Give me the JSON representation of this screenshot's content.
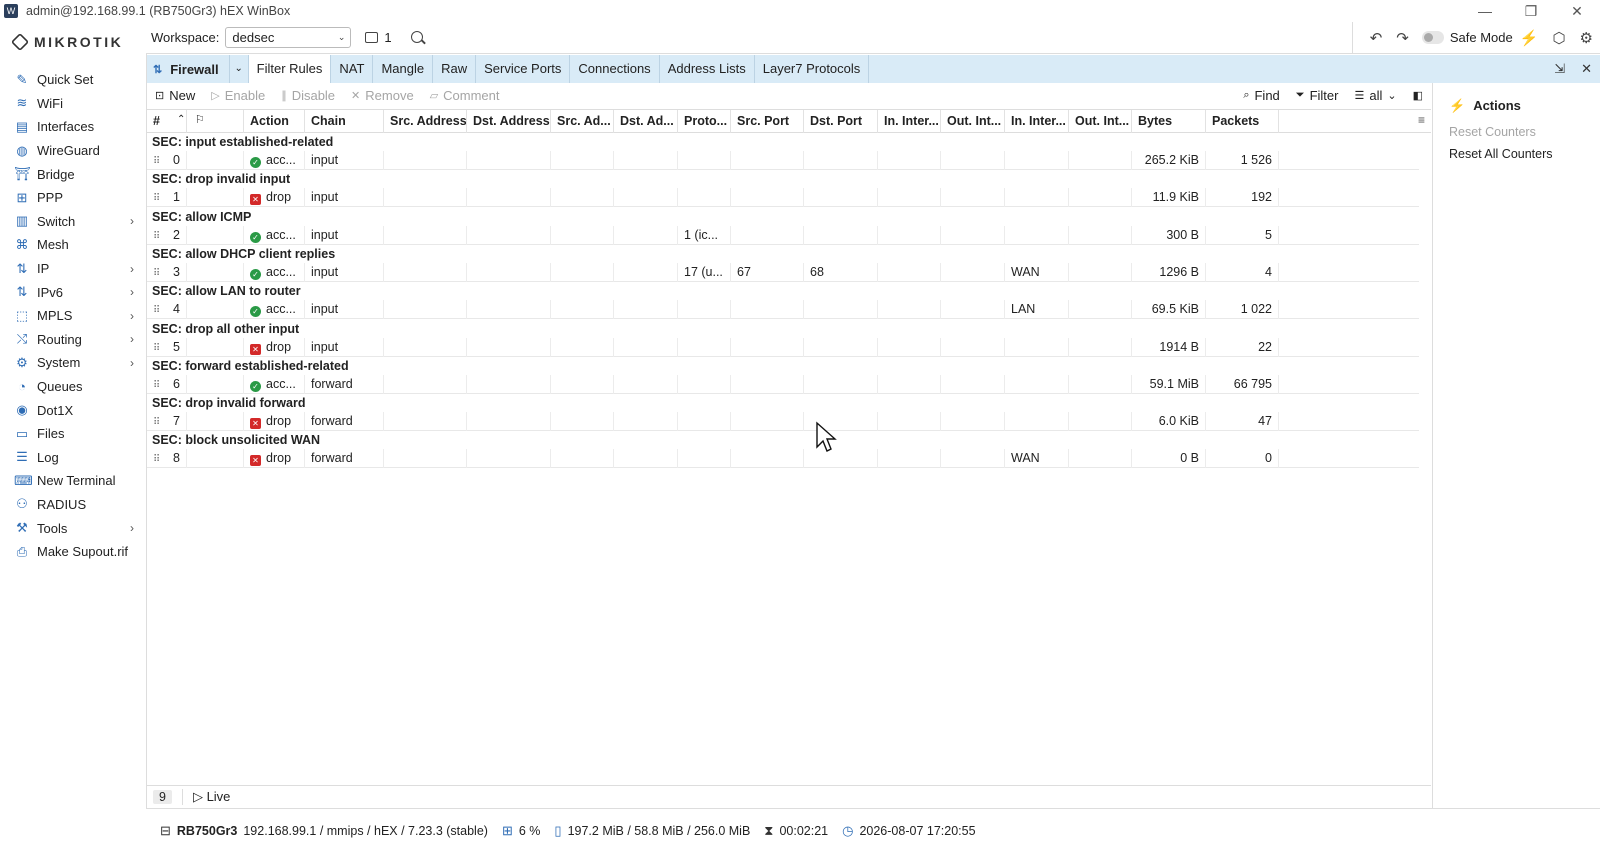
{
  "window_title": "admin@192.168.99.1 (RB750Gr3) hEX WinBox",
  "logo_text": "MIKROTIK",
  "sidebar": {
    "items": [
      {
        "label": "Quick Set",
        "icon": "wand-icon",
        "glyph": "✎",
        "has_submenu": false
      },
      {
        "label": "WiFi",
        "icon": "wifi-icon",
        "glyph": "≋",
        "has_submenu": false
      },
      {
        "label": "Interfaces",
        "icon": "interfaces-icon",
        "glyph": "▤",
        "has_submenu": false
      },
      {
        "label": "WireGuard",
        "icon": "wireguard-icon",
        "glyph": "◍",
        "has_submenu": false
      },
      {
        "label": "Bridge",
        "icon": "bridge-icon",
        "glyph": "⛩",
        "has_submenu": false
      },
      {
        "label": "PPP",
        "icon": "ppp-icon",
        "glyph": "⊞",
        "has_submenu": false
      },
      {
        "label": "Switch",
        "icon": "switch-icon",
        "glyph": "▥",
        "has_submenu": true
      },
      {
        "label": "Mesh",
        "icon": "mesh-icon",
        "glyph": "⌘",
        "has_submenu": false
      },
      {
        "label": "IP",
        "icon": "ip-icon",
        "glyph": "⇅",
        "has_submenu": true
      },
      {
        "label": "IPv6",
        "icon": "ipv6-icon",
        "glyph": "⇅",
        "has_submenu": true
      },
      {
        "label": "MPLS",
        "icon": "mpls-icon",
        "glyph": "⬚",
        "has_submenu": true
      },
      {
        "label": "Routing",
        "icon": "routing-icon",
        "glyph": "⤭",
        "has_submenu": true
      },
      {
        "label": "System",
        "icon": "gear-icon",
        "glyph": "⚙",
        "has_submenu": true
      },
      {
        "label": "Queues",
        "icon": "queues-icon",
        "glyph": "◔",
        "has_submenu": false
      },
      {
        "label": "Dot1X",
        "icon": "dot1x-icon",
        "glyph": "◉",
        "has_submenu": false
      },
      {
        "label": "Files",
        "icon": "folder-icon",
        "glyph": "▭",
        "has_submenu": false
      },
      {
        "label": "Log",
        "icon": "log-icon",
        "glyph": "☰",
        "has_submenu": false
      },
      {
        "label": "New Terminal",
        "icon": "terminal-icon",
        "glyph": "⌨",
        "has_submenu": false
      },
      {
        "label": "RADIUS",
        "icon": "radius-icon",
        "glyph": "⚇",
        "has_submenu": false
      },
      {
        "label": "Tools",
        "icon": "tools-icon",
        "glyph": "⚒",
        "has_submenu": true
      },
      {
        "label": "Make Supout.rif",
        "icon": "supout-icon",
        "glyph": "⎙",
        "has_submenu": false
      }
    ]
  },
  "topbar": {
    "workspace_label": "Workspace:",
    "workspace_value": "dedsec",
    "window_count": "1",
    "safe_mode_label": "Safe Mode"
  },
  "tabs": {
    "window_title": "Firewall",
    "items": [
      "Filter Rules",
      "NAT",
      "Mangle",
      "Raw",
      "Service Ports",
      "Connections",
      "Address Lists",
      "Layer7 Protocols"
    ],
    "active": "Filter Rules"
  },
  "toolbar": {
    "new": "New",
    "enable": "Enable",
    "disable": "Disable",
    "remove": "Remove",
    "comment": "Comment",
    "find": "Find",
    "filter": "Filter",
    "all": "all"
  },
  "table": {
    "columns": [
      "#",
      "",
      "Action",
      "Chain",
      "Src. Address",
      "Dst. Address",
      "Src. Ad...",
      "Dst. Ad...",
      "Proto...",
      "Src. Port",
      "Dst. Port",
      "In. Inter...",
      "Out. Int...",
      "In. Inter...",
      "Out. Int...",
      "Bytes",
      "Packets"
    ],
    "rows": [
      {
        "comment": "SEC: input established-related",
        "num": "0",
        "action": "acc...",
        "action_type": "accept",
        "chain": "input",
        "protocol": "",
        "src_port": "",
        "dst_port": "",
        "in_iface_list": "",
        "bytes": "265.2 KiB",
        "packets": "1 526"
      },
      {
        "comment": "SEC: drop invalid input",
        "num": "1",
        "action": "drop",
        "action_type": "drop",
        "chain": "input",
        "protocol": "",
        "src_port": "",
        "dst_port": "",
        "in_iface_list": "",
        "bytes": "11.9 KiB",
        "packets": "192"
      },
      {
        "comment": "SEC: allow ICMP",
        "num": "2",
        "action": "acc...",
        "action_type": "accept",
        "chain": "input",
        "protocol": "1 (ic...",
        "src_port": "",
        "dst_port": "",
        "in_iface_list": "",
        "bytes": "300 B",
        "packets": "5"
      },
      {
        "comment": "SEC: allow DHCP client replies",
        "num": "3",
        "action": "acc...",
        "action_type": "accept",
        "chain": "input",
        "protocol": "17 (u...",
        "src_port": "67",
        "dst_port": "68",
        "in_iface_list": "WAN",
        "bytes": "1296 B",
        "packets": "4"
      },
      {
        "comment": "SEC: allow LAN to router",
        "num": "4",
        "action": "acc...",
        "action_type": "accept",
        "chain": "input",
        "protocol": "",
        "src_port": "",
        "dst_port": "",
        "in_iface_list": "LAN",
        "bytes": "69.5 KiB",
        "packets": "1 022"
      },
      {
        "comment": "SEC: drop all other input",
        "num": "5",
        "action": "drop",
        "action_type": "drop",
        "chain": "input",
        "protocol": "",
        "src_port": "",
        "dst_port": "",
        "in_iface_list": "",
        "bytes": "1914 B",
        "packets": "22"
      },
      {
        "comment": "SEC: forward established-related",
        "num": "6",
        "action": "acc...",
        "action_type": "accept",
        "chain": "forward",
        "protocol": "",
        "src_port": "",
        "dst_port": "",
        "in_iface_list": "",
        "bytes": "59.1 MiB",
        "packets": "66 795"
      },
      {
        "comment": "SEC: drop invalid forward",
        "num": "7",
        "action": "drop",
        "action_type": "drop",
        "chain": "forward",
        "protocol": "",
        "src_port": "",
        "dst_port": "",
        "in_iface_list": "",
        "bytes": "6.0 KiB",
        "packets": "47"
      },
      {
        "comment": "SEC: block unsolicited WAN",
        "num": "8",
        "action": "drop",
        "action_type": "drop",
        "chain": "forward",
        "protocol": "",
        "src_port": "",
        "dst_port": "",
        "in_iface_list": "WAN",
        "bytes": "0 B",
        "packets": "0"
      }
    ]
  },
  "footer": {
    "count": "9",
    "live": "Live"
  },
  "actions_panel": {
    "title": "Actions",
    "items": [
      "Reset Counters",
      "Reset All Counters"
    ]
  },
  "statusbar": {
    "model": "RB750Gr3",
    "info": "192.168.99.1 / mmips / hEX / 7.23.3 (stable)",
    "cpu": "6 %",
    "memory": "197.2 MiB / 58.8 MiB / 256.0 MiB",
    "uptime": "00:02:21",
    "datetime": "2026-08-07 17:20:55"
  },
  "colors": {
    "accent": "#2f6db5",
    "tabbar_bg": "#d9ebf7",
    "accept": "#2a9a46",
    "drop": "#d32929"
  }
}
